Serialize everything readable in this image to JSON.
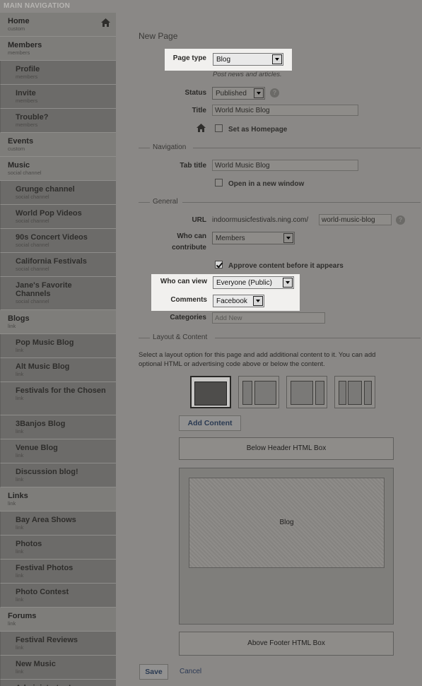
{
  "sidebar": {
    "header": "MAIN NAVIGATION",
    "items": [
      {
        "label": "Home",
        "type": "custom",
        "level": "top"
      },
      {
        "label": "Members",
        "type": "members",
        "level": "top"
      },
      {
        "label": "Profile",
        "type": "members",
        "level": "sub"
      },
      {
        "label": "Invite",
        "type": "members",
        "level": "sub"
      },
      {
        "label": "Trouble?",
        "type": "members",
        "level": "sub"
      },
      {
        "label": "Events",
        "type": "custom",
        "level": "top"
      },
      {
        "label": "Music",
        "type": "social channel",
        "level": "top"
      },
      {
        "label": "Grunge channel",
        "type": "social channel",
        "level": "sub"
      },
      {
        "label": "World Pop Videos",
        "type": "social channel",
        "level": "sub"
      },
      {
        "label": "90s Concert Videos",
        "type": "social channel",
        "level": "sub"
      },
      {
        "label": "California Festivals",
        "type": "social channel",
        "level": "sub"
      },
      {
        "label": "Jane's Favorite Channels",
        "type": "social channel",
        "level": "sub",
        "tall": true
      },
      {
        "label": "Blogs",
        "type": "link",
        "level": "top"
      },
      {
        "label": "Pop Music Blog",
        "type": "link",
        "level": "sub"
      },
      {
        "label": "Alt Music Blog",
        "type": "link",
        "level": "sub"
      },
      {
        "label": "Festivals for the Chosen",
        "type": "link",
        "level": "sub",
        "tall": true
      },
      {
        "label": "3Banjos Blog",
        "type": "link",
        "level": "sub"
      },
      {
        "label": "Venue Blog",
        "type": "link",
        "level": "sub"
      },
      {
        "label": "Discussion blog!",
        "type": "link",
        "level": "sub"
      },
      {
        "label": "Links",
        "type": "link",
        "level": "top"
      },
      {
        "label": "Bay Area Shows",
        "type": "link",
        "level": "sub"
      },
      {
        "label": "Photos",
        "type": "link",
        "level": "sub"
      },
      {
        "label": "Festival Photos",
        "type": "link",
        "level": "sub"
      },
      {
        "label": "Photo Contest",
        "type": "link",
        "level": "sub"
      },
      {
        "label": "Forums",
        "type": "link",
        "level": "top"
      },
      {
        "label": "Festival Reviews",
        "type": "link",
        "level": "sub"
      },
      {
        "label": "New Music",
        "type": "link",
        "level": "sub"
      },
      {
        "label": "Administrator Logs",
        "type": "link",
        "level": "sub"
      }
    ]
  },
  "form": {
    "title": "New Page",
    "page_type_label": "Page type",
    "page_type_value": "Blog",
    "page_type_hint": "Post news and articles.",
    "status_label": "Status",
    "status_value": "Published",
    "title_label": "Title",
    "title_value": "World Music Blog",
    "homepage_label": "Set as Homepage",
    "navigation_legend": "Navigation",
    "tab_title_label": "Tab title",
    "tab_title_value": "World Music Blog",
    "new_window_label": "Open in a new window",
    "general_legend": "General",
    "url_label": "URL",
    "url_prefix": "indoormusicfestivals.ning.com/",
    "url_value": "world-music-blog",
    "contribute_label_1": "Who can",
    "contribute_label_2": "contribute",
    "contribute_value": "Members",
    "approve_label": "Approve content before it appears",
    "view_label": "Who can view",
    "view_value": "Everyone (Public)",
    "comments_label": "Comments",
    "comments_value": "Facebook",
    "categories_label": "Categories",
    "categories_placeholder": "Add New",
    "layout_legend": "Layout & Content",
    "layout_desc_1": "Select a layout option for this page and add additional content to it. You can add",
    "layout_desc_2": "optional HTML or advertising code above or below the content.",
    "add_content_label": "Add Content",
    "below_header_label": "Below Header HTML Box",
    "content_label": "Blog",
    "above_footer_label": "Above Footer HTML Box",
    "save_label": "Save",
    "cancel_label": "Cancel",
    "help_glyph": "?"
  },
  "colors": {
    "overlay_bg": "#8a8886",
    "sidebar_bg": "#7b7a77",
    "highlight_bg": "#f1f0ee",
    "link": "#2c3a55"
  }
}
